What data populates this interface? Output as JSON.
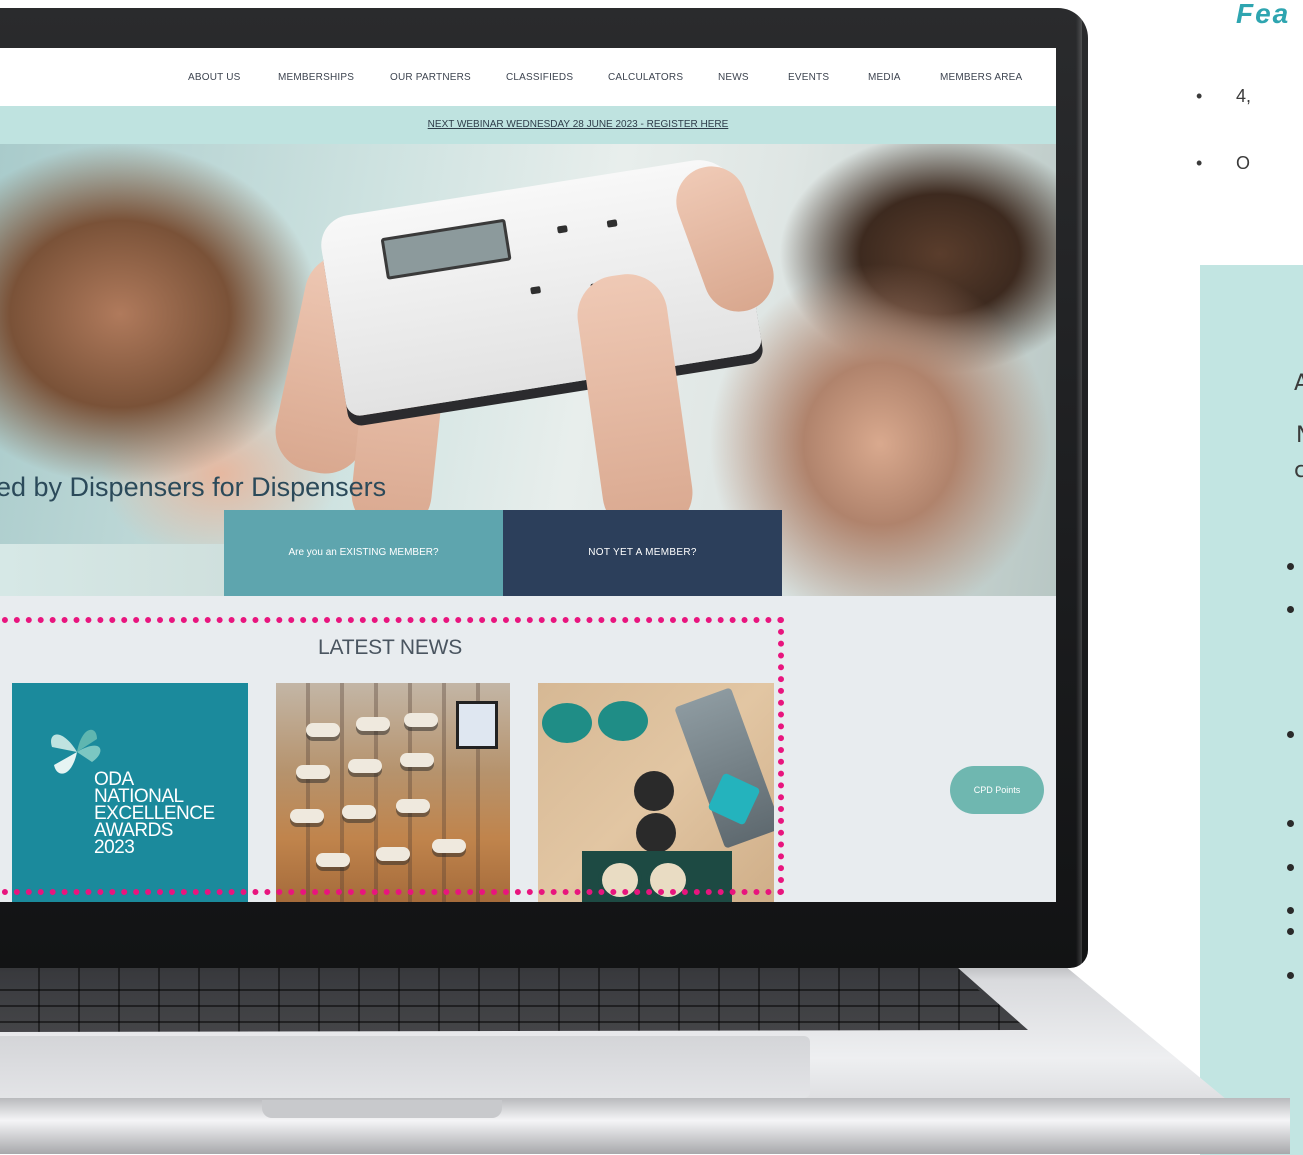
{
  "nav": {
    "items": [
      "ABOUT US",
      "MEMBERSHIPS",
      "OUR PARTNERS",
      "CLASSIFIEDS",
      "CALCULATORS",
      "NEWS",
      "EVENTS",
      "MEDIA",
      "MEMBERS AREA"
    ]
  },
  "webinar": {
    "text": "NEXT WEBINAR WEDNESDAY 28 JUNE 2023 - REGISTER HERE"
  },
  "hero": {
    "tagline": "ed by Dispensers for Dispensers",
    "existing_member_label": "Are you an EXISTING MEMBER?",
    "new_member_label": "NOT YET A MEMBER?"
  },
  "news": {
    "heading": "LATEST NEWS",
    "oda_card_lines": [
      "ODA",
      "NATIONAL",
      "EXCELLENCE",
      "AWARDS",
      "2023"
    ]
  },
  "cpd_button": {
    "label": "CPD Points"
  },
  "slide": {
    "heading": "Fea",
    "bullets": [
      "4,",
      "O"
    ],
    "box_letters": [
      "A",
      "N",
      "c"
    ]
  },
  "colors": {
    "highlight": "#e8157e",
    "teal": "#5ea5ae",
    "navy": "#2c3f5b",
    "accent": "#2ea5b0"
  }
}
